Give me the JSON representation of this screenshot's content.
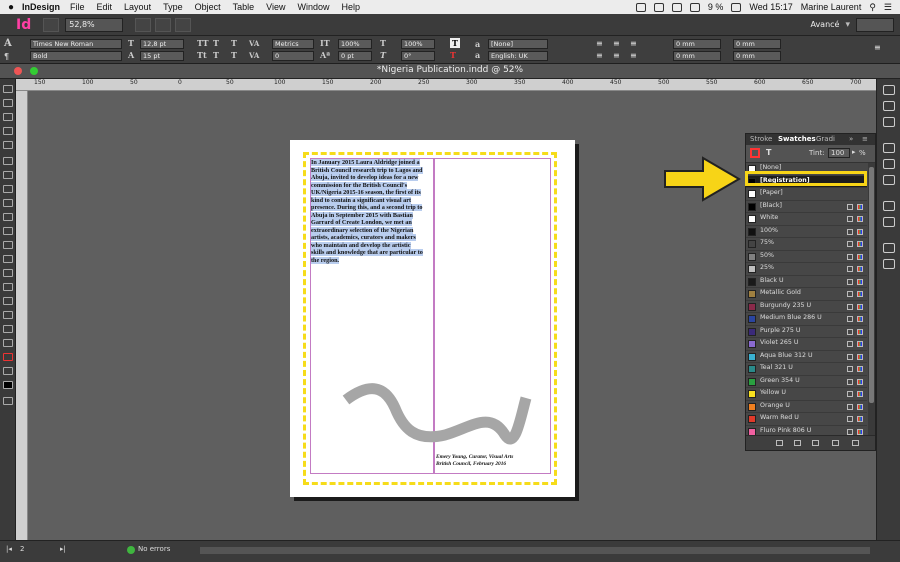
{
  "menubar": {
    "app": "InDesign",
    "items": [
      "File",
      "Edit",
      "Layout",
      "Type",
      "Object",
      "Table",
      "View",
      "Window",
      "Help"
    ],
    "battery": "9 %",
    "clock": "Wed 15:17",
    "user": "Marine Laurent"
  },
  "appbar": {
    "logo": "Id",
    "zoom": "52,8%",
    "workspace": "Avancé"
  },
  "control": {
    "font": "Times New Roman",
    "style": "Bold",
    "size": "12,8 pt",
    "leading": "15 pt",
    "kerning": "Metrics",
    "tracking": "0",
    "vscale": "100%",
    "hscale": "100%",
    "baseline": "0 pt",
    "skew": "0°",
    "charstyle": "[None]",
    "language": "English: UK",
    "indent1": "0 mm",
    "indent2": "0 mm",
    "indent3": "0 mm",
    "indent4": "0 mm"
  },
  "document": {
    "tab": "*Nigeria Publication.indd @ 52%"
  },
  "ruler": [
    "150",
    "100",
    "50",
    "0",
    "50",
    "100",
    "150",
    "200",
    "250",
    "300",
    "350",
    "400",
    "450",
    "500",
    "550",
    "600",
    "650",
    "700"
  ],
  "page": {
    "story": "In January 2015 Laura Aldridge joined a British Council research trip to Lagos and Abuja, invited to develop ideas for a new commission for the British Council's UK/Nigeria 2015-16 season, the first of its kind to contain a significant visual art presence. During this, and a second trip to Abuja in September 2015 with Bastian Garrard of Create London, we met an extraordinary selection of the Nigerian artists, academics, curators and makers who maintain and develop the artistic skills and knowledge that are particular to the region.",
    "caption_line1": "Emery Young, Curator, Visual Arts",
    "caption_line2": "British Council, February 2016"
  },
  "panel": {
    "tabs": [
      "Stroke",
      "Swatches",
      "Gradi"
    ],
    "tint_label": "Tint:",
    "tint_value": "100",
    "tint_unit": "%",
    "swatches": [
      {
        "name": "[None]",
        "color": "#ffffff"
      },
      {
        "name": "[Registration]",
        "color": "#000000"
      },
      {
        "name": "[Paper]",
        "color": "#ffffff"
      },
      {
        "name": "[Black]",
        "color": "#000000"
      },
      {
        "name": "White",
        "color": "#ffffff"
      },
      {
        "name": "100%",
        "color": "#111111"
      },
      {
        "name": "75%",
        "color": "#444444"
      },
      {
        "name": "50%",
        "color": "#808080"
      },
      {
        "name": "25%",
        "color": "#bfbfbf"
      },
      {
        "name": "Black U",
        "color": "#1a1a1a"
      },
      {
        "name": "Metallic Gold",
        "color": "#a08040"
      },
      {
        "name": "Burgundy 235 U",
        "color": "#8a2a4a"
      },
      {
        "name": "Medium Blue 286 U",
        "color": "#2a45a0"
      },
      {
        "name": "Purple 275 U",
        "color": "#3b2a7a"
      },
      {
        "name": "Violet 265 U",
        "color": "#8a6ad0"
      },
      {
        "name": "Aqua Blue 312 U",
        "color": "#3ab0d0"
      },
      {
        "name": "Teal 321 U",
        "color": "#2a8a8a"
      },
      {
        "name": "Green 354 U",
        "color": "#2aa040"
      },
      {
        "name": "Yellow U",
        "color": "#f7e020"
      },
      {
        "name": "Orange U",
        "color": "#f08020"
      },
      {
        "name": "Warm Red U",
        "color": "#e03a2a"
      },
      {
        "name": "Fluro Pink 806 U",
        "color": "#f060a0"
      }
    ]
  },
  "status": {
    "page": "2",
    "errors": "No errors"
  },
  "colors": {
    "accent_pink": "#ff3fa4",
    "highlight_yellow": "#f7d417",
    "guide_purple": "#c37bc3"
  }
}
